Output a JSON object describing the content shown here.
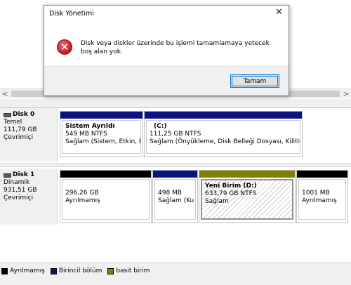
{
  "dialog": {
    "title": "Disk Yönetimi",
    "close_glyph": "✕",
    "error_glyph": "✕",
    "message": "Disk veya diskler üzerinde bu işlemi tamamlamaya yetecek boş alan yok.",
    "ok_label": "Tamam"
  },
  "scrollbar": {
    "left_arrow": "<",
    "right_arrow": ">"
  },
  "disks": [
    {
      "name": "Disk 0",
      "type": "Temel",
      "size": "111,79 GB",
      "status": "Çevrimiçi",
      "partitions": [
        {
          "title": "Sistem Ayrıldı",
          "line2": "549 MB NTFS",
          "line3": "Sağlam (Sistem, Etkin, Bi",
          "bar_color": "#0a1280"
        },
        {
          "title": "(C:)",
          "line2": "111,25 GB NTFS",
          "line3": "Sağlam (Önyükleme, Disk Belleği Dosyası, Kilitle",
          "bar_color": "#0a1280"
        }
      ]
    },
    {
      "name": "Disk 1",
      "type": "Dinamik",
      "size": "931,51 GB",
      "status": "Çevrimiçi",
      "partitions": [
        {
          "title": "",
          "line2": "296,26 GB",
          "line3": "Ayrılmamış",
          "bar_color": "#000000"
        },
        {
          "title": "",
          "line2": "498 MB",
          "line3": "Sağlam (Ku",
          "bar_color": "#0a1280"
        },
        {
          "title": "Yeni Birim  (D:)",
          "line2": "633,79 GB NTFS",
          "line3": "Sağlam",
          "bar_color": "#808000"
        },
        {
          "title": "",
          "line2": "1001 MB",
          "line3": "Ayrılmamış",
          "bar_color": "#000000"
        }
      ]
    }
  ],
  "legend": [
    {
      "label": "Ayrılmamış",
      "color": "#000000"
    },
    {
      "label": "Birincil bölüm",
      "color": "#0a1280"
    },
    {
      "label": "basit birim",
      "color": "#808000"
    }
  ]
}
